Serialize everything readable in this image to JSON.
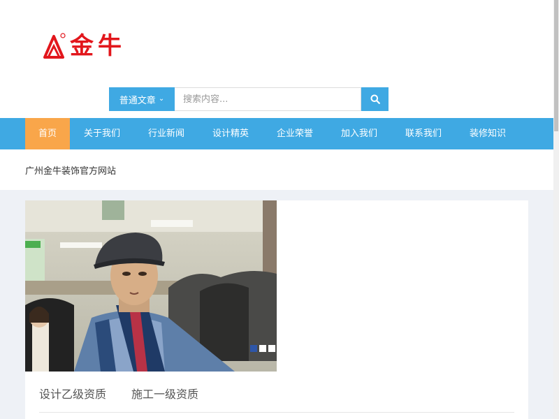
{
  "header": {
    "logo": {
      "text": "金牛"
    }
  },
  "search": {
    "type_label": "普通文章",
    "placeholder": "搜索内容...",
    "button_icon": "search-icon"
  },
  "nav": {
    "items": [
      {
        "label": "首页",
        "active": true
      },
      {
        "label": "关于我们"
      },
      {
        "label": "行业新闻"
      },
      {
        "label": "设计精英"
      },
      {
        "label": "企业荣誉"
      },
      {
        "label": "加入我们"
      },
      {
        "label": "联系我们"
      },
      {
        "label": "装修知识"
      }
    ]
  },
  "site_name": "广州金牛装饰官方网站",
  "slider": {
    "slide_count": 3,
    "active_index": 0
  },
  "qualifications": [
    "设计乙级资质",
    "施工一级资质"
  ],
  "colors": {
    "primary": "#3fa9e3",
    "active_nav": "#f9a64a",
    "logo_red": "#e2161c",
    "page_bg": "#eef1f6"
  }
}
